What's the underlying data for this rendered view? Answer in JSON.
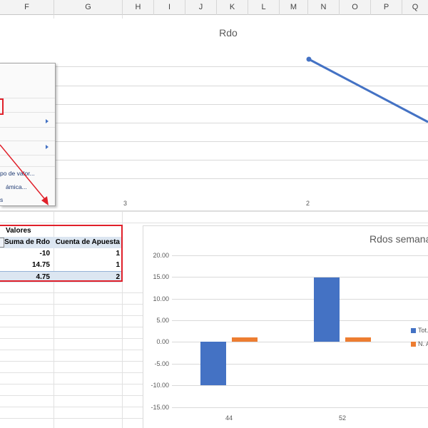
{
  "columns": [
    "F",
    "G",
    "H",
    "I",
    "J",
    "K",
    "L",
    "M",
    "N",
    "O",
    "P",
    "Q"
  ],
  "chart1": {
    "title": "Rdo",
    "x_labels": [
      "3",
      "2"
    ]
  },
  "context_menu": {
    "item_valor": "po de valor...",
    "item_dinamica": "ámica...",
    "item_s": "s"
  },
  "pivot": {
    "header": "Valores",
    "col1": "Suma de Rdo",
    "col2": "Cuenta de Apuesta",
    "rows": [
      {
        "rdo": "-10",
        "cuenta": "1"
      },
      {
        "rdo": "14.75",
        "cuenta": "1"
      },
      {
        "rdo": "4.75",
        "cuenta": "2"
      }
    ]
  },
  "chart2": {
    "title": "Rdos semana",
    "y_ticks": [
      "20.00",
      "15.00",
      "10.00",
      "5.00",
      "0.00",
      "-5.00",
      "-10.00",
      "-15.00"
    ],
    "legend": [
      "Tot.",
      "N. A"
    ]
  },
  "chart_data": [
    {
      "type": "line",
      "title": "Rdo",
      "x": [
        "3",
        "2"
      ]
    },
    {
      "type": "bar",
      "title": "Rdos semana",
      "categories": [
        "44",
        "52"
      ],
      "ylim": [
        -15,
        20
      ],
      "series": [
        {
          "name": "Tot.",
          "values": [
            -10,
            14.75
          ],
          "color": "#4472c4"
        },
        {
          "name": "N. A",
          "values": [
            1,
            1
          ],
          "color": "#ed7d31"
        }
      ],
      "grid": true,
      "legend": "right"
    }
  ],
  "colors": {
    "accent_red": "#e0202a",
    "series_blue": "#4472c4",
    "series_orange": "#ed7d31"
  }
}
